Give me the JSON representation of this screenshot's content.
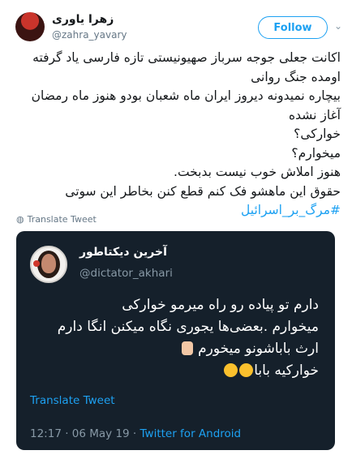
{
  "author": {
    "name": "زهرا یاوری",
    "handle": "@zahra_yavary"
  },
  "follow_label": "Follow",
  "tweet_lines": [
    "اکانت جعلی جوجه سرباز صهیونیستی تازه فارسی یاد گرفته",
    "اومده جنگ روانی",
    "بیچاره نمیدونه دیروز ایران ماه شعبان بودو هنوز ماه رمضان",
    "آغاز نشده",
    "خوارکی؟",
    "میخوارم؟",
    "هنوز املاش خوب نیست بدبخت.",
    "حقوق این ماهشو فک کنم قطع کنن بخاطر این سوتی"
  ],
  "hashtag": "#مرگ_بر_اسرائیل",
  "translate_tweet": "Translate Tweet",
  "quoted": {
    "name": "آخرین دیکتاطور",
    "handle": "@dictator_akhari",
    "lines": [
      "دارم تو پیاده رو راه میرمو خوارکی",
      "میخوارم .بعضی‌ها یجوری نگاه میکنن انگا دارم",
      "ارث باباشونو میخورم",
      "خوارکیه بابا"
    ],
    "translate": "Translate Tweet",
    "time": "12:17 · 06 May 19 · ",
    "app": "Twitter for Android"
  }
}
